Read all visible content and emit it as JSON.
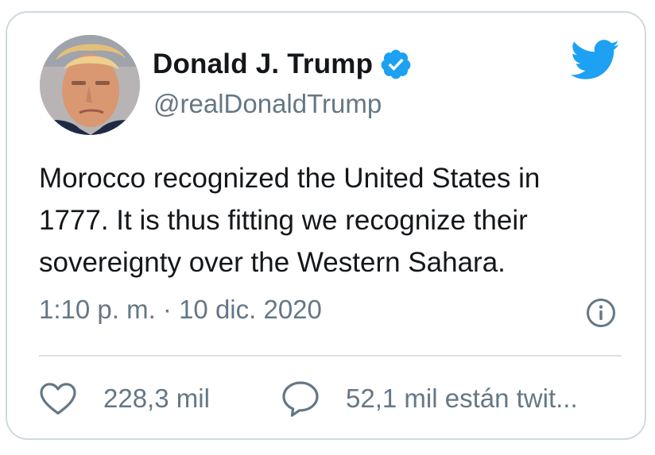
{
  "tweet": {
    "author": {
      "display_name": "Donald J. Trump",
      "handle": "@realDonaldTrump",
      "verified": true
    },
    "text": "Morocco recognized the United States in\n1777.  It is thus fitting we recognize their\nsovereignty over the Western Sahara.",
    "timestamp": "1:10 p. m. · 10 dic. 2020",
    "likes_label": "228,3 mil",
    "replies_label": "52,1 mil están twit..."
  },
  "icons": {
    "brand": "twitter-bird-icon",
    "verified": "verified-badge-icon",
    "info": "info-icon",
    "like": "heart-icon",
    "reply": "speech-bubble-icon"
  },
  "colors": {
    "brand_blue": "#1da1f2",
    "text_primary": "#14171a",
    "text_secondary": "#657786",
    "border": "#cfd9de"
  }
}
